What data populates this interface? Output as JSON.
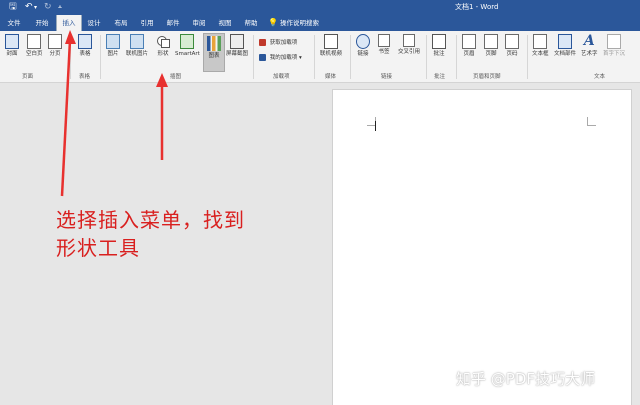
{
  "window": {
    "title": "文档1 - Word"
  },
  "quick_access": {
    "save_icon": "save-icon",
    "undo_icon": "undo-icon",
    "redo_icon": "redo-icon",
    "customize_icon": "customize-icon"
  },
  "tabs": [
    {
      "label": "文件"
    },
    {
      "label": "开始"
    },
    {
      "label": "插入",
      "active": true
    },
    {
      "label": "设计"
    },
    {
      "label": "布局"
    },
    {
      "label": "引用"
    },
    {
      "label": "邮件"
    },
    {
      "label": "审阅"
    },
    {
      "label": "视图"
    },
    {
      "label": "帮助"
    }
  ],
  "tell_me": {
    "label": "操作说明搜索",
    "icon": "lightbulb-icon"
  },
  "ribbon": {
    "pages": {
      "cover": "封面",
      "blank": "空白页",
      "break": "分页",
      "group": "页面"
    },
    "tables": {
      "table": "表格",
      "group": "表格"
    },
    "illustrations": {
      "picture": "图片",
      "online_picture": "联机图片",
      "shapes": "形状",
      "smartart": "SmartArt",
      "chart": "图表",
      "screenshot": "屏幕截图",
      "group": "插图"
    },
    "addins": {
      "get": "获取加载项",
      "mine": "我的加载项",
      "group": "加载项"
    },
    "media": {
      "online_video": "联机视频",
      "group": "媒体"
    },
    "links": {
      "link": "链接",
      "bookmark": "书签",
      "crossref": "交叉引用",
      "group": "链接"
    },
    "comments": {
      "comment": "批注",
      "group": "批注"
    },
    "header_footer": {
      "header": "页眉",
      "footer": "页脚",
      "page_number": "页码",
      "group": "页眉和页脚"
    },
    "text": {
      "textbox": "文本框",
      "quickparts": "文档部件",
      "wordart": "艺术字",
      "dropcap": "首字下沉",
      "group": "文本"
    }
  },
  "annotation": {
    "line1": "选择插入菜单，找到",
    "line2": "形状工具",
    "color": "#d9201f"
  },
  "watermark": {
    "text": "知乎 @PDF技巧大师"
  }
}
